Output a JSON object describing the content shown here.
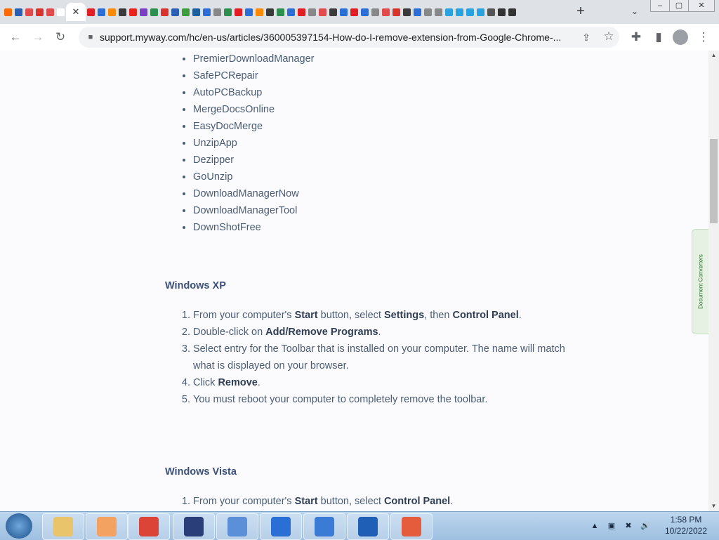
{
  "browser": {
    "tab_favicons": [
      "#ff6a00",
      "#2b5fb4",
      "#e24b4b",
      "#d9342b",
      "#e24b4b",
      "#ffffff",
      "#e21e25",
      "#2b6ed6",
      "#ff8a00",
      "#3a3a3a",
      "#e8221c",
      "#7a3ec8",
      "#2d8f4e",
      "#d9342b",
      "#2b5fb4",
      "#3a9e3a",
      "#1b5f9e",
      "#2b6ed6",
      "#888888",
      "#2d8f4e",
      "#e21e25",
      "#2b6ed6",
      "#ff8a00",
      "#3a3a3a",
      "#2d8f4e",
      "#2b6ed6",
      "#e21e25",
      "#888888",
      "#e24b4b",
      "#3a3a3a",
      "#2b6ed6",
      "#e21e25",
      "#2b6ed6",
      "#888888",
      "#e24b4b",
      "#d9342b",
      "#3a3a3a",
      "#2b6ed6",
      "#888888",
      "#888888",
      "#29a3e0",
      "#29a3e0",
      "#29a3e0",
      "#29a3e0",
      "#555555",
      "#333333",
      "#333333"
    ],
    "active_tab_close": "✕",
    "new_tab": "+",
    "tab_search": "⌄",
    "window_min": "–",
    "window_max": "▢",
    "window_close": "✕",
    "back": "←",
    "forward": "→",
    "reload": "↻",
    "url": "support.myway.com/hc/en-us/articles/360005397154-How-do-I-remove-extension-from-Google-Chrome-...",
    "share": "⇪",
    "bookmark_star": "☆",
    "extensions": "✚",
    "sidepanel": "▮",
    "menu": "⋮"
  },
  "article": {
    "toolbar_list": [
      "PremierDownloadManager",
      "SafePCRepair",
      "AutoPCBackup",
      "MergeDocsOnline",
      "EasyDocMerge",
      "UnzipApp",
      "Dezipper",
      "GoUnzip",
      "DownloadManagerNow",
      "DownloadManagerTool",
      "DownShotFree"
    ],
    "xp": {
      "heading": "Windows XP",
      "steps": [
        {
          "parts": [
            {
              "t": "From your computer's "
            },
            {
              "t": "Start",
              "b": true
            },
            {
              "t": " button, select "
            },
            {
              "t": "Settings",
              "b": true
            },
            {
              "t": ", then "
            },
            {
              "t": "Control Panel",
              "b": true
            },
            {
              "t": "."
            }
          ]
        },
        {
          "parts": [
            {
              "t": "Double-click on "
            },
            {
              "t": "Add/Remove Programs",
              "b": true
            },
            {
              "t": "."
            }
          ]
        },
        {
          "parts": [
            {
              "t": "Select entry for the Toolbar that is installed on your computer.  The name will match what is displayed on your browser."
            }
          ]
        },
        {
          "parts": [
            {
              "t": "Click "
            },
            {
              "t": "Remove",
              "b": true
            },
            {
              "t": "."
            }
          ]
        },
        {
          "parts": [
            {
              "t": "You must reboot your computer to completely remove the toolbar."
            }
          ]
        }
      ]
    },
    "vista": {
      "heading": "Windows Vista",
      "steps": [
        {
          "parts": [
            {
              "t": "From your computer's "
            },
            {
              "t": "Start",
              "b": true
            },
            {
              "t": " button, select "
            },
            {
              "t": "Control Panel",
              "b": true
            },
            {
              "t": "."
            }
          ]
        }
      ]
    }
  },
  "side_widget": {
    "label": "Document Converters"
  },
  "taskbar": {
    "apps": [
      {
        "name": "explorer",
        "color": "#e9c46a"
      },
      {
        "name": "media-player",
        "color": "#f4a261"
      },
      {
        "name": "chrome",
        "color": "#db4437"
      },
      {
        "name": "settings-gear",
        "color": "#2a3f7a"
      },
      {
        "name": "network-computer",
        "color": "#5b8fd8"
      },
      {
        "name": "remote-desktop",
        "color": "#2a6fd6"
      },
      {
        "name": "shield-check",
        "color": "#3a7bd5"
      },
      {
        "name": "shield-slash",
        "color": "#1f5fb5"
      },
      {
        "name": "office-squares",
        "color": "#e55c3c"
      }
    ],
    "tray_icons": [
      "▲",
      "▣",
      "✖",
      "🔊"
    ],
    "time": "1:58 PM",
    "date": "10/22/2022"
  }
}
